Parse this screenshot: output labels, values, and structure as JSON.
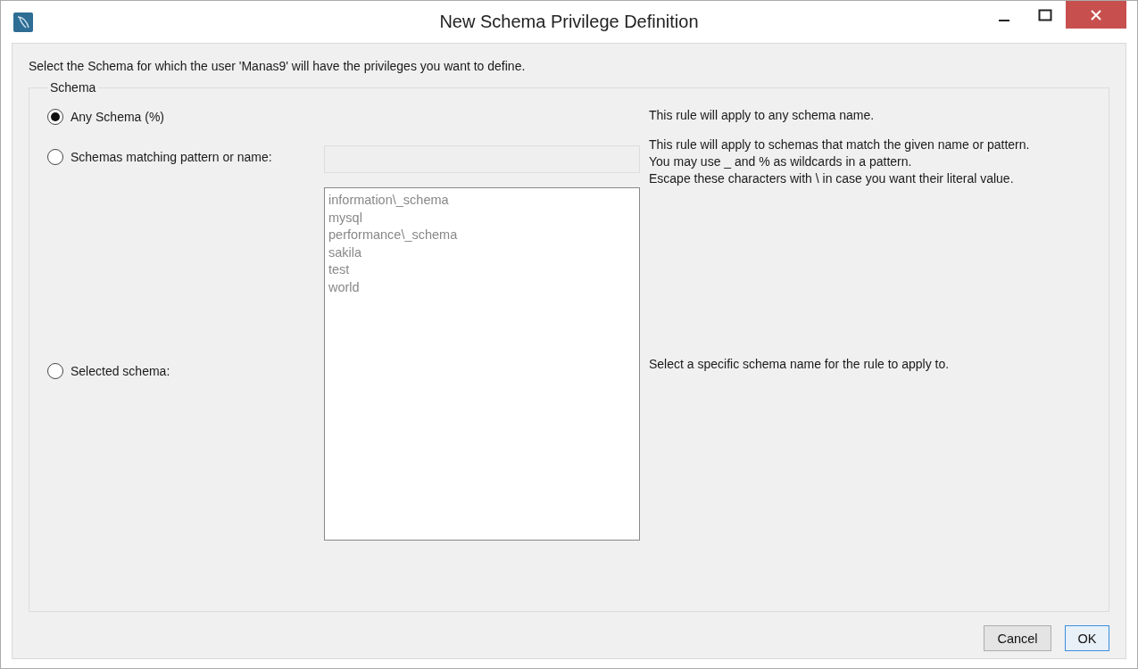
{
  "window": {
    "title": "New Schema Privilege Definition"
  },
  "intro": "Select the Schema for which the user 'Manas9' will have the privileges you want to define.",
  "group": {
    "title": "Schema",
    "options": [
      {
        "kind": "any",
        "label": "Any Schema (%)",
        "selected": true,
        "description": "This rule will apply to any schema name."
      },
      {
        "kind": "pattern",
        "label": "Schemas matching pattern or name:",
        "selected": false,
        "description": "This rule will apply to schemas that match the given name or pattern.\nYou may use _ and % as wildcards in a pattern.\nEscape these characters with \\ in case you want their literal value.",
        "field": {
          "disabled": true
        }
      },
      {
        "kind": "list",
        "label": "Selected schema:",
        "selected": false,
        "description": "Select a specific schema name for the rule to apply to.",
        "list": {
          "disabled": true,
          "items": [
            "information\\_schema",
            "mysql",
            "performance\\_schema",
            "sakila",
            "test",
            "world"
          ]
        }
      }
    ]
  },
  "buttons": [
    {
      "label": "Cancel",
      "default": false
    },
    {
      "label": "OK",
      "default": true
    }
  ]
}
